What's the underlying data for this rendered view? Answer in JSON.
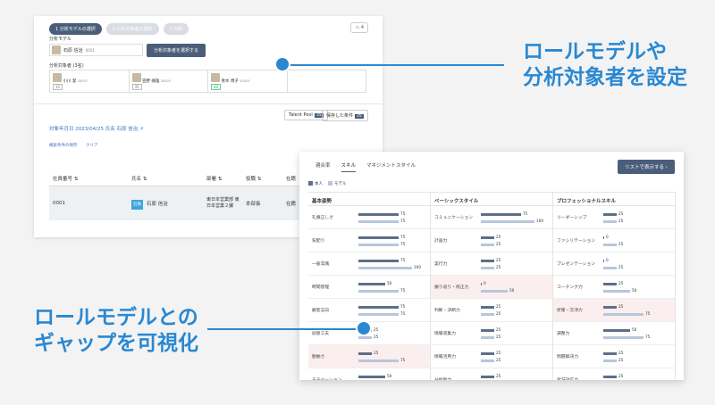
{
  "steps": [
    "1 分析モデルの選択",
    "2 分析対象者の選択",
    "3 分析"
  ],
  "folder_count": "4",
  "model_label": "分析モデル",
  "model_name": "石原 信治",
  "model_id": "0001",
  "select_button": "分析対象者を選択する",
  "targets_label": "分析対象者 (3名)",
  "targets": [
    {
      "name": "小川 潔",
      "id": "20007",
      "badge": "35"
    },
    {
      "name": "笠野 颯雄",
      "id": "30003",
      "badge": "35"
    },
    {
      "name": "青木 博子",
      "id": "10003",
      "badge": "44"
    }
  ],
  "talent_pool": {
    "label": "Talent Pool",
    "count": "35"
  },
  "saved_conditions": {
    "label": "保存した条件",
    "count": "35"
  },
  "filter_link": "対象年月日 2023/04/25  氏名 石原 信治",
  "search_save": "検索条件の保存",
  "clear": "クリア",
  "table": {
    "headers": [
      "社員番号",
      "氏名",
      "部署",
      "役職",
      "在籍"
    ],
    "row": {
      "id": "0001",
      "tag": "社員",
      "name": "石原 信治",
      "dept": "東日本営業部 東日本営業２課",
      "title": "本部長",
      "status": "在籍"
    }
  },
  "tabs": [
    "適合率",
    "スキル",
    "マネジメントスタイル"
  ],
  "list_button": "リストで表示する",
  "legend": {
    "person": "本人",
    "model": "モデル"
  },
  "columns": [
    {
      "title": "基本姿勢",
      "skills": [
        {
          "name": "礼儀正しさ",
          "p": 75,
          "m": 75,
          "hl": false
        },
        {
          "name": "気配り",
          "p": 75,
          "m": 75,
          "hl": false
        },
        {
          "name": "一般常識",
          "p": 75,
          "m": 100,
          "hl": false
        },
        {
          "name": "時間管理",
          "p": 50,
          "m": 75,
          "hl": false
        },
        {
          "name": "顧客志向",
          "p": 75,
          "m": 75,
          "hl": false
        },
        {
          "name": "創意工夫",
          "p": 25,
          "m": 25,
          "hl": false
        },
        {
          "name": "勤勉さ",
          "p": 25,
          "m": 75,
          "hl": true
        },
        {
          "name": "モチベーション",
          "p": 50,
          "m": null,
          "hl": false
        }
      ]
    },
    {
      "title": "ベーシックスタイル",
      "skills": [
        {
          "name": "コミュニケーション",
          "p": 75,
          "m": 100,
          "hl": false
        },
        {
          "name": "計画力",
          "p": 25,
          "m": 25,
          "hl": false
        },
        {
          "name": "実行力",
          "p": 25,
          "m": 25,
          "hl": false
        },
        {
          "name": "振り返り・修正力",
          "p": 0,
          "m": 50,
          "hl": true
        },
        {
          "name": "判断・決断力",
          "p": 25,
          "m": 25,
          "hl": false
        },
        {
          "name": "情報収集力",
          "p": 25,
          "m": 25,
          "hl": false
        },
        {
          "name": "情報活用力",
          "p": 25,
          "m": 25,
          "hl": false
        },
        {
          "name": "分析能力",
          "p": 25,
          "m": null,
          "hl": false
        }
      ]
    },
    {
      "title": "プロフェッショナルスキル",
      "skills": [
        {
          "name": "リーダーシップ",
          "p": 25,
          "m": 25,
          "hl": false
        },
        {
          "name": "ファシリテーション",
          "p": 0,
          "m": 25,
          "hl": false
        },
        {
          "name": "プレゼンテーション",
          "p": 0,
          "m": 25,
          "hl": false
        },
        {
          "name": "コーチング力",
          "p": 25,
          "m": 50,
          "hl": false
        },
        {
          "name": "折衝・交渉力",
          "p": 25,
          "m": 75,
          "hl": true
        },
        {
          "name": "調整力",
          "p": 50,
          "m": 75,
          "hl": false
        },
        {
          "name": "問題解決力",
          "p": 25,
          "m": 25,
          "hl": false
        },
        {
          "name": "状況対応力",
          "p": 25,
          "m": null,
          "hl": false
        }
      ]
    }
  ],
  "callout1": [
    "ロールモデルや",
    "分析対象者を設定"
  ],
  "callout2": [
    "ロールモデルとの",
    "ギャップを可視化"
  ],
  "colors": {
    "accent": "#2a88d1",
    "person_bar": "#5d6f87",
    "model_bar": "#b7c7dc",
    "gap_highlight": "#fbeeee"
  }
}
